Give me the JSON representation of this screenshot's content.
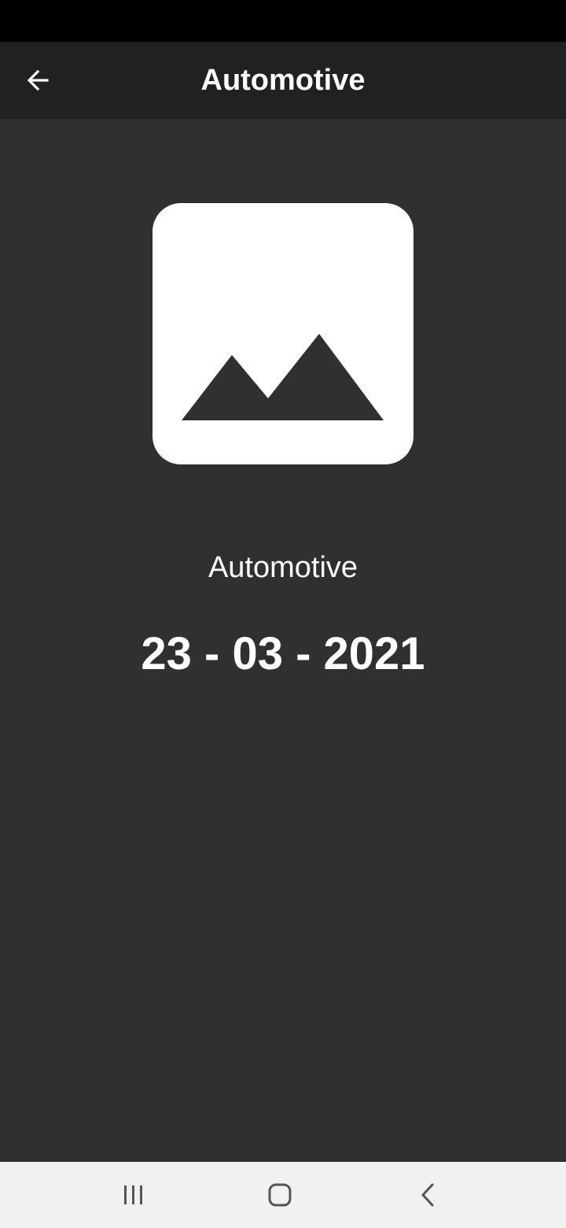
{
  "app_bar": {
    "title": "Automotive",
    "back_icon": "arrow-left-icon"
  },
  "detail": {
    "image_icon": "image-placeholder-icon",
    "name": "Automotive",
    "date": "23 - 03 - 2021"
  },
  "navigation": {
    "recents_icon": "recents-icon",
    "home_icon": "home-icon",
    "back_icon": "back-chevron-icon"
  },
  "colors": {
    "background": "#303030",
    "app_bar": "#212121",
    "status_bar": "#000000",
    "nav_bar": "#f1f1f1",
    "text": "#ffffff"
  }
}
